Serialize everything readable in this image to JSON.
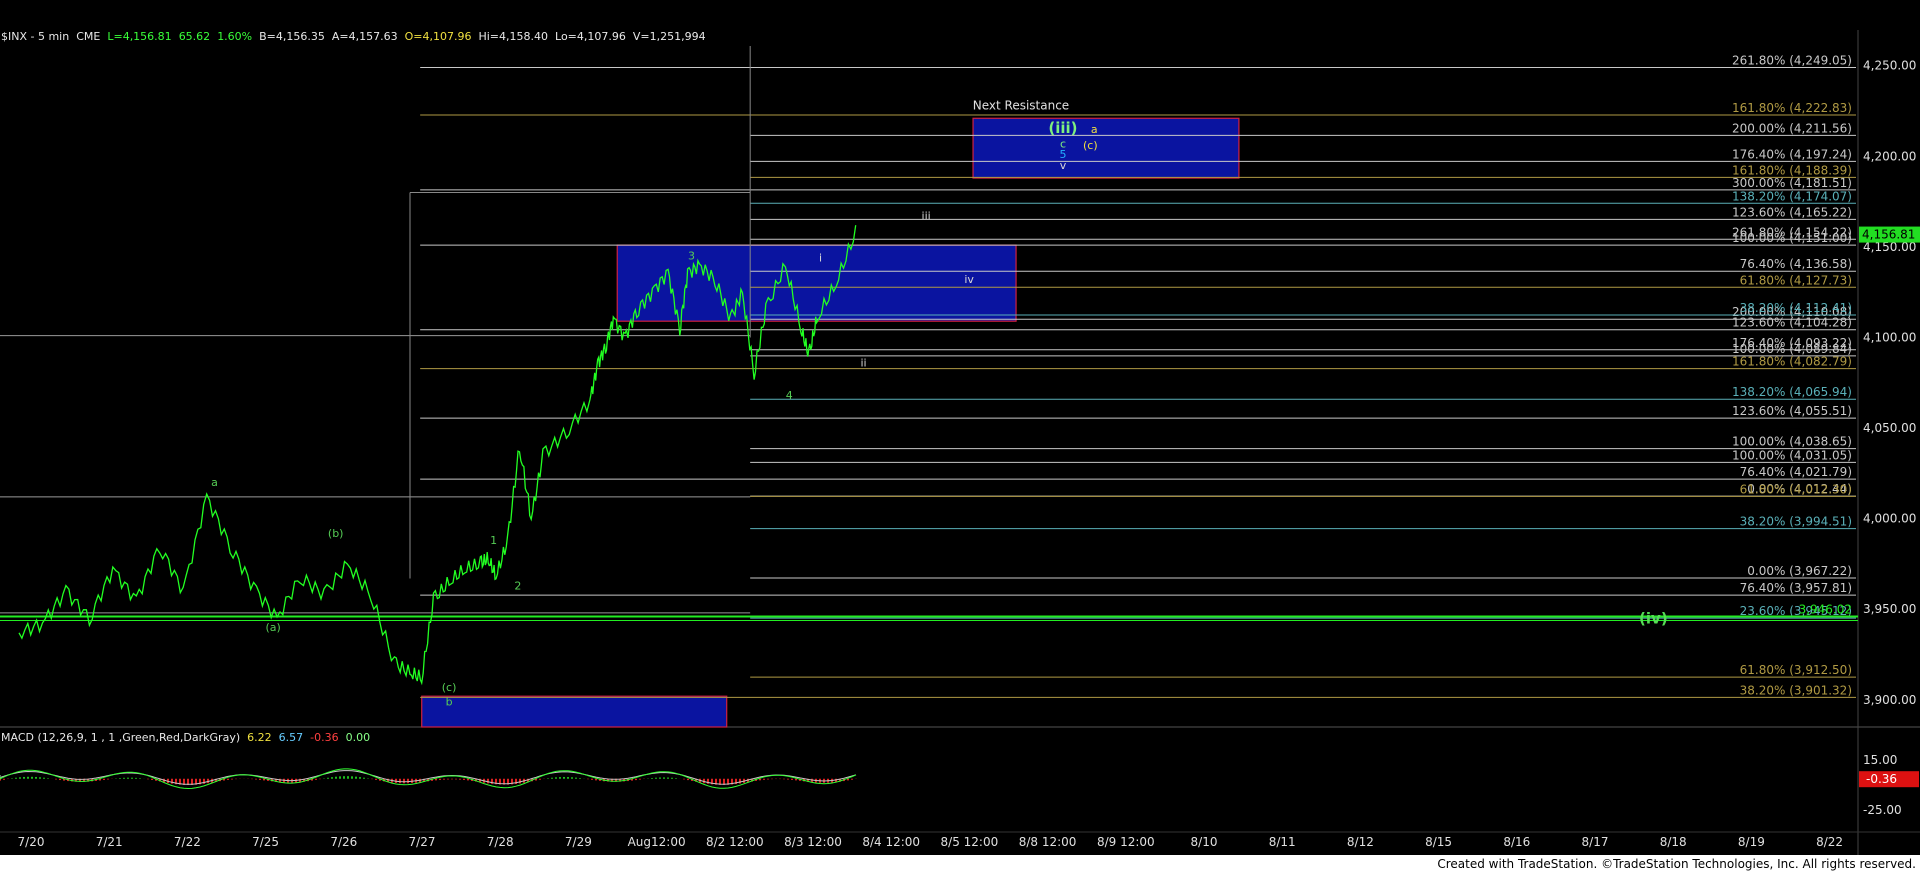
{
  "header": {
    "symbol": "$INX - 5 min",
    "exchange": "CME",
    "last": "L=4,156.81",
    "chg": "65.62",
    "pct": "1.60%",
    "bid": "B=4,156.35",
    "ask": "A=4,157.63",
    "open": "O=4,107.96",
    "high": "Hi=4,158.40",
    "low": "Lo=4,107.96",
    "vol": "V=1,251,994"
  },
  "macd": {
    "title": "MACD (12,26,9, 1 , 1 ,Green,Red,DarkGray)",
    "v1": "6.22",
    "v2": "6.57",
    "v3": "-0.36",
    "v4": "0.00",
    "ticks": [
      "15.00",
      "-25.00"
    ],
    "last_label": "-0.36"
  },
  "footer": {
    "credit": "Created with TradeStation. ©TradeStation Technologies, Inc. All rights reserved."
  },
  "colors": {
    "price": "#22ff22",
    "box": "#0a14a0",
    "box_border": "#d02040",
    "fib_white": "#c8c8c8",
    "fib_gold": "#b09a44",
    "fib_cyan": "#5ab0b8",
    "bg": "#000000",
    "axis_text": "#e0e0e0"
  },
  "chart_data": {
    "type": "line",
    "title": "",
    "xlabel": "",
    "ylabel": "",
    "ylim": [
      3885,
      4262
    ],
    "y_ticks": [
      "4,250.00",
      "4,200.00",
      "4,150.00",
      "4,100.00",
      "4,050.00",
      "4,000.00",
      "3,950.00",
      "3,900.00"
    ],
    "last_price_label": "4,156.81",
    "x_ticks": [
      "7/20",
      "7/21",
      "7/22",
      "7/25",
      "7/26",
      "7/27",
      "7/28",
      "7/29",
      "Aug12:00",
      "8/2 12:00",
      "8/3 12:00",
      "8/4 12:00",
      "8/5 12:00",
      "8/8 12:00",
      "8/9 12:00",
      "8/10",
      "8/11",
      "8/12",
      "8/15",
      "8/16",
      "8/17",
      "8/18",
      "8/19",
      "8/22"
    ],
    "series": [
      {
        "points": [
          [
            0,
            3937
          ],
          [
            0.3,
            3942
          ],
          [
            0.6,
            3960
          ],
          [
            0.9,
            3945
          ],
          [
            1.2,
            3972
          ],
          [
            1.5,
            3955
          ],
          [
            1.8,
            3985
          ],
          [
            2.1,
            3960
          ],
          [
            2.4,
            4012
          ],
          [
            2.7,
            3985
          ],
          [
            3.0,
            3962
          ],
          [
            3.3,
            3945
          ],
          [
            3.6,
            3968
          ],
          [
            3.9,
            3958
          ],
          [
            4.2,
            3975
          ],
          [
            4.5,
            3958
          ],
          [
            4.8,
            3920
          ],
          [
            5.0,
            3915
          ],
          [
            5.15,
            3912
          ],
          [
            5.3,
            3955
          ],
          [
            5.5,
            3965
          ],
          [
            5.7,
            3972
          ],
          [
            5.9,
            3975
          ],
          [
            6.0,
            3978
          ],
          [
            6.1,
            3968
          ],
          [
            6.25,
            3988
          ],
          [
            6.4,
            4040
          ],
          [
            6.55,
            4000
          ],
          [
            6.7,
            4035
          ],
          [
            7.0,
            4048
          ],
          [
            7.3,
            4065
          ],
          [
            7.4,
            4085
          ],
          [
            7.5,
            4095
          ],
          [
            7.6,
            4110
          ],
          [
            7.75,
            4100
          ],
          [
            7.9,
            4115
          ],
          [
            8.1,
            4125
          ],
          [
            8.3,
            4136
          ],
          [
            8.45,
            4105
          ],
          [
            8.55,
            4135
          ],
          [
            8.7,
            4140
          ],
          [
            8.9,
            4132
          ],
          [
            9.1,
            4110
          ],
          [
            9.25,
            4125
          ],
          [
            9.4,
            4080
          ],
          [
            9.55,
            4115
          ],
          [
            9.8,
            4140
          ],
          [
            10.0,
            4105
          ],
          [
            10.1,
            4090
          ],
          [
            10.2,
            4110
          ],
          [
            10.45,
            4130
          ],
          [
            10.7,
            4158
          ]
        ]
      }
    ],
    "fib_levels_gold": [
      {
        "label": "161.80% (4,222.83)",
        "value": 4222.83
      },
      {
        "label": "161.80% (4,188.39)",
        "value": 4188.39
      },
      {
        "label": "61.80% (4,127.73)",
        "value": 4127.73
      },
      {
        "label": "161.80% (4,082.79)",
        "value": 4082.79
      },
      {
        "label": "61.80% (4,012.30)",
        "value": 4012.3
      },
      {
        "label": "61.80% (3,912.50)",
        "value": 3912.5
      },
      {
        "label": "38.20% (3,901.32)",
        "value": 3901.32
      }
    ],
    "fib_levels_white": [
      {
        "label": "261.80% (4,249.05)",
        "value": 4249.05
      },
      {
        "label": "200.00% (4,211.56)",
        "value": 4211.56
      },
      {
        "label": "176.40% (4,197.24)",
        "value": 4197.24
      },
      {
        "label": "300.00% (4,181.51)",
        "value": 4181.51
      },
      {
        "label": "123.60% (4,165.22)",
        "value": 4165.22
      },
      {
        "label": "261.80% (4,154.22)",
        "value": 4154.22
      },
      {
        "label": "100.00% (4,151.00)",
        "value": 4151.0
      },
      {
        "label": "76.40% (4,136.58)",
        "value": 4136.58
      },
      {
        "label": "200.00% (4,110.08)",
        "value": 4110.08
      },
      {
        "label": "123.60% (4,104.28)",
        "value": 4104.28
      },
      {
        "label": "176.40% (4,093.22)",
        "value": 4093.22
      },
      {
        "label": "100.00% (4,089.84)",
        "value": 4089.84
      },
      {
        "label": "123.60% (4,055.51)",
        "value": 4055.51
      },
      {
        "label": "100.00% (4,038.65)",
        "value": 4038.65
      },
      {
        "label": "100.00% (4,031.05)",
        "value": 4031.05
      },
      {
        "label": "76.40% (4,021.79)",
        "value": 4021.79
      },
      {
        "label": "0.00% (4,012.44)",
        "value": 4012.44
      },
      {
        "label": "0.00% (3,967.22)",
        "value": 3967.22
      },
      {
        "label": "76.40% (3,957.81)",
        "value": 3957.81
      }
    ],
    "fib_levels_cyan": [
      {
        "label": "138.20% (4,174.07)",
        "value": 4174.07
      },
      {
        "label": "38.20% (4,112.41)",
        "value": 4112.41
      },
      {
        "label": "138.20% (4,065.94)",
        "value": 4065.94
      },
      {
        "label": "38.20% (3,994.51)",
        "value": 3994.51
      },
      {
        "label": "23.60% (3,945.12)",
        "value": 3945.12
      }
    ],
    "support_line": {
      "label": "3,946.02",
      "value": 3946.02
    },
    "resistance_box": {
      "label": "Next Resistance",
      "x0": 12.2,
      "x1": 15.6,
      "y0": 4188,
      "y1": 4221
    },
    "blue_box_1": {
      "x0": 7.65,
      "x1": 12.75,
      "y0": 4109,
      "y1": 4151
    },
    "blue_box_2": {
      "x0": 5.15,
      "x1": 9.05,
      "y0": 3885,
      "y1": 3902
    },
    "wave_labels": [
      {
        "text": "a",
        "x": 2.5,
        "y": 4018,
        "color": "#55cc55"
      },
      {
        "text": "(b)",
        "x": 4.05,
        "y": 3990,
        "color": "#55cc55"
      },
      {
        "text": "(a)",
        "x": 3.25,
        "y": 3938,
        "color": "#55cc55"
      },
      {
        "text": "(c)",
        "x": 5.5,
        "y": 3905,
        "color": "#55cc55"
      },
      {
        "text": "b",
        "x": 5.5,
        "y": 3897,
        "color": "#55cc55"
      },
      {
        "text": "1",
        "x": 6.07,
        "y": 3986,
        "color": "#55cc55"
      },
      {
        "text": "2",
        "x": 6.38,
        "y": 3961,
        "color": "#55cc55"
      },
      {
        "text": "3",
        "x": 8.6,
        "y": 4143,
        "color": "#55cc55"
      },
      {
        "text": "4",
        "x": 9.85,
        "y": 4066,
        "color": "#55cc55"
      },
      {
        "text": "i",
        "x": 10.25,
        "y": 4142,
        "color": "#d8d8d8"
      },
      {
        "text": "ii",
        "x": 10.8,
        "y": 4084,
        "color": "#d8d8d8"
      },
      {
        "text": "iii",
        "x": 11.6,
        "y": 4165,
        "color": "#d8d8d8"
      },
      {
        "text": "iv",
        "x": 12.15,
        "y": 4130,
        "color": "#d8d8d8"
      },
      {
        "text": "(iii)",
        "x": 13.35,
        "y": 4213,
        "color": "#7ef07e"
      },
      {
        "text": "a",
        "x": 13.75,
        "y": 4213,
        "color": "#f0e040"
      },
      {
        "text": "c",
        "x": 13.35,
        "y": 4205,
        "color": "#7ef07e"
      },
      {
        "text": "(c)",
        "x": 13.7,
        "y": 4204,
        "color": "#f0e040"
      },
      {
        "text": "5",
        "x": 13.35,
        "y": 4199,
        "color": "#22b0ff"
      },
      {
        "text": "v",
        "x": 13.35,
        "y": 4193,
        "color": "#d8d8d8"
      },
      {
        "text": "(iv)",
        "x": 20.9,
        "y": 3942,
        "color": "#55dd55"
      }
    ]
  }
}
